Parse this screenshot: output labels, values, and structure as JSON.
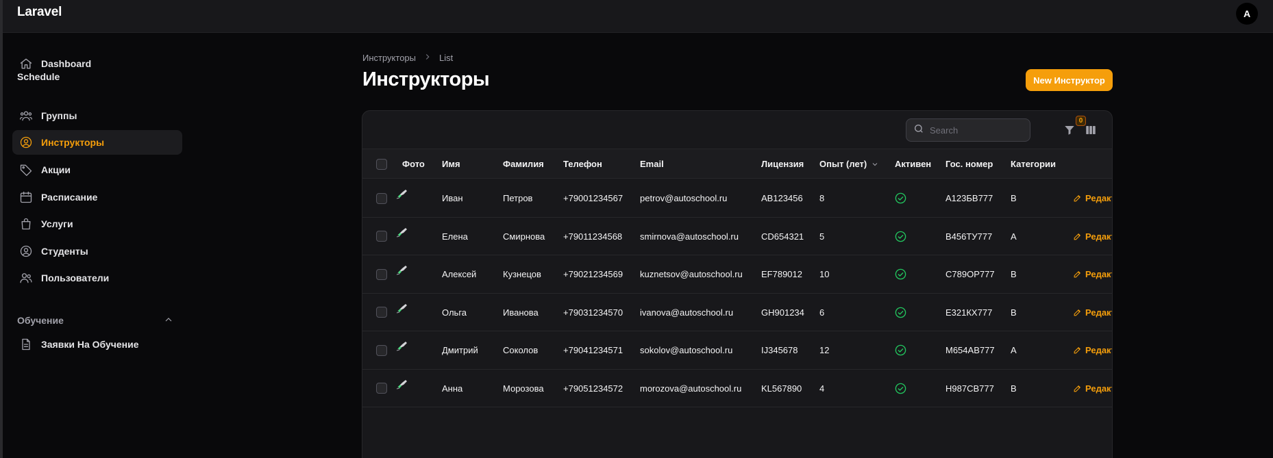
{
  "app": {
    "brand": "Laravel",
    "user_initial": "A"
  },
  "sidebar": {
    "dashboard": "Dashboard",
    "group_schedule": "Schedule",
    "items": [
      {
        "label": "Группы",
        "icon": "users-group-icon"
      },
      {
        "label": "Инструкторы",
        "icon": "user-circle-icon",
        "active": true
      },
      {
        "label": "Акции",
        "icon": "tag-icon"
      },
      {
        "label": "Расписание",
        "icon": "calendar-icon"
      },
      {
        "label": "Услуги",
        "icon": "shopping-bag-icon"
      },
      {
        "label": "Студенты",
        "icon": "user-circle-icon"
      },
      {
        "label": "Пользователи",
        "icon": "users-icon"
      }
    ],
    "group_training": "Обучение",
    "training_items": [
      {
        "label": "Заявки На Обучение",
        "icon": "document-icon"
      }
    ]
  },
  "breadcrumb": {
    "parent": "Инструкторы",
    "current": "List"
  },
  "page": {
    "title": "Инструкторы",
    "new_button": "New Инструктор"
  },
  "table": {
    "search_placeholder": "Search",
    "filter_count": "0",
    "columns": [
      "Фото",
      "Имя",
      "Фамилия",
      "Телефон",
      "Email",
      "Лицензия",
      "Опыт (лет)",
      "Активен",
      "Гос. номер",
      "Категории"
    ],
    "edit_label": "Редактировать",
    "rows": [
      {
        "first": "Иван",
        "last": "Петров",
        "phone": "+79001234567",
        "email": "petrov@autoschool.ru",
        "license": "AB123456",
        "exp": "8",
        "plate": "А123БВ777",
        "cat": "B"
      },
      {
        "first": "Елена",
        "last": "Смирнова",
        "phone": "+79011234568",
        "email": "smirnova@autoschool.ru",
        "license": "CD654321",
        "exp": "5",
        "plate": "В456ТУ777",
        "cat": "A"
      },
      {
        "first": "Алексей",
        "last": "Кузнецов",
        "phone": "+79021234569",
        "email": "kuznetsov@autoschool.ru",
        "license": "EF789012",
        "exp": "10",
        "plate": "С789ОР777",
        "cat": "B"
      },
      {
        "first": "Ольга",
        "last": "Иванова",
        "phone": "+79031234570",
        "email": "ivanova@autoschool.ru",
        "license": "GH901234",
        "exp": "6",
        "plate": "Е321КХ777",
        "cat": "B"
      },
      {
        "first": "Дмитрий",
        "last": "Соколов",
        "phone": "+79041234571",
        "email": "sokolov@autoschool.ru",
        "license": "IJ345678",
        "exp": "12",
        "plate": "М654АВ777",
        "cat": "A"
      },
      {
        "first": "Анна",
        "last": "Морозова",
        "phone": "+79051234572",
        "email": "morozova@autoschool.ru",
        "license": "KL567890",
        "exp": "4",
        "plate": "Н987СВ777",
        "cat": "B"
      }
    ]
  },
  "colors": {
    "accent": "#f59e0b",
    "success": "#22c55e",
    "background": "#09090b",
    "panel": "#18181b"
  }
}
